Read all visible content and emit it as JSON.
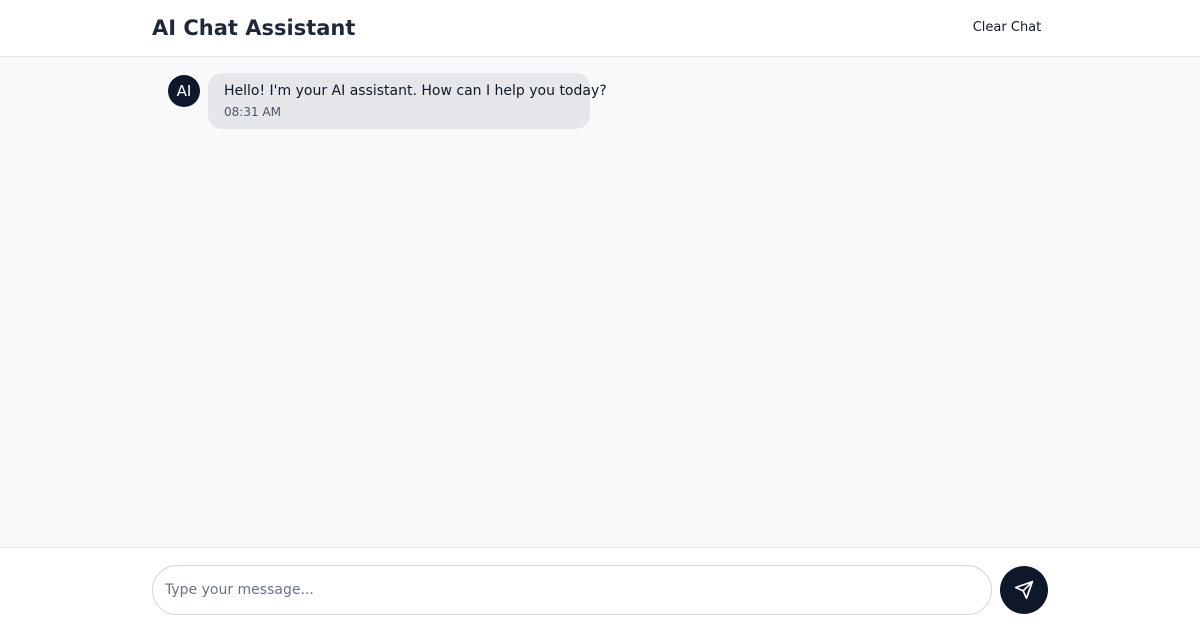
{
  "header": {
    "title": "AI Chat Assistant",
    "clear_label": "Clear Chat"
  },
  "messages": [
    {
      "sender": "assistant",
      "avatar_text": "AI",
      "text": "Hello! I'm your AI assistant. How can I help you today?",
      "time": "08:31 AM"
    }
  ],
  "composer": {
    "placeholder": "Type your message...",
    "value": "",
    "send_icon": "send-icon"
  },
  "colors": {
    "accent": "#0f172a",
    "assistant_bubble": "#e5e7eb",
    "chat_background": "#f8fafc"
  }
}
